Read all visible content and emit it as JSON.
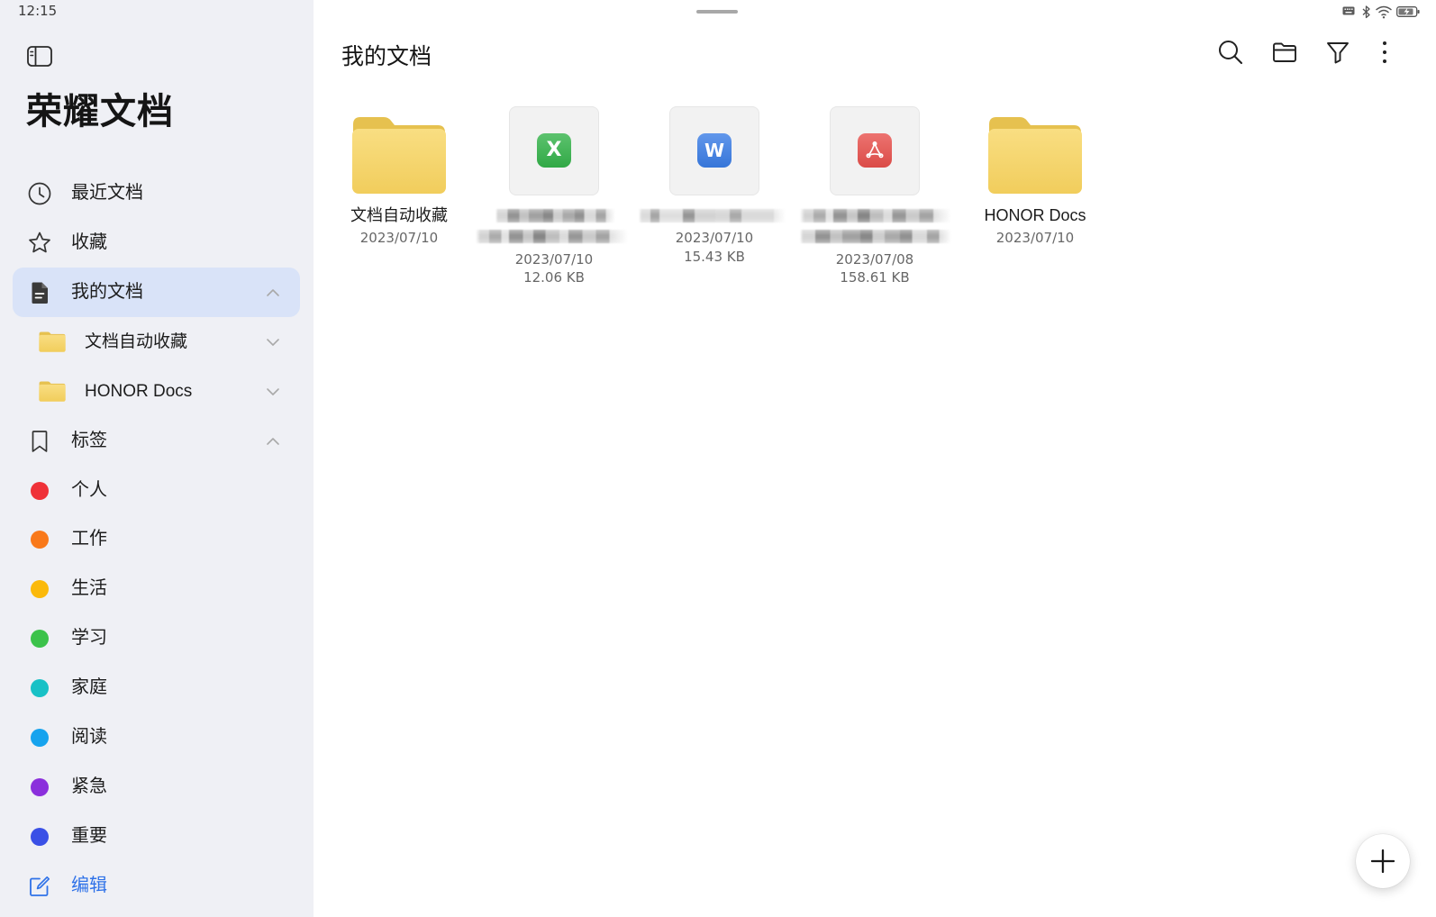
{
  "status_bar": {
    "time": "12:15",
    "icons": [
      "keyboard-icon",
      "bluetooth-icon",
      "wifi-icon",
      "battery-charging-icon"
    ]
  },
  "theme": {
    "accent": "#2f72e8",
    "sidebar_bg": "#eff0f5",
    "selected_bg": "#d9e3f8"
  },
  "sidebar": {
    "toggle_icon": "sidebar-toggle-icon",
    "app_title": "荣耀文档",
    "nav": {
      "recent": {
        "label": "最近文档",
        "icon": "clock-icon"
      },
      "favorites": {
        "label": "收藏",
        "icon": "star-icon"
      },
      "my_docs": {
        "label": "我的文档",
        "icon": "document-icon",
        "selected": true,
        "chevron": "chevron-up-icon"
      }
    },
    "folders": [
      {
        "label": "文档自动收藏",
        "icon": "folder-icon",
        "chevron": "chevron-down-icon"
      },
      {
        "label": "HONOR Docs",
        "icon": "folder-icon",
        "chevron": "chevron-down-icon"
      }
    ],
    "tags_section": {
      "label": "标签",
      "icon": "bookmark-icon",
      "chevron": "chevron-up-icon"
    },
    "tags": [
      {
        "label": "个人",
        "color": "#ef3138"
      },
      {
        "label": "工作",
        "color": "#f9791a"
      },
      {
        "label": "生活",
        "color": "#fbb90a"
      },
      {
        "label": "学习",
        "color": "#3bc24a"
      },
      {
        "label": "家庭",
        "color": "#18c1c6"
      },
      {
        "label": "阅读",
        "color": "#16a3ee"
      },
      {
        "label": "紧急",
        "color": "#8b2fdc"
      },
      {
        "label": "重要",
        "color": "#3a50e6"
      }
    ],
    "edit": {
      "label": "编辑",
      "icon": "edit-icon"
    }
  },
  "main": {
    "title": "我的文档",
    "toolbar": [
      {
        "icon": "search-icon"
      },
      {
        "icon": "folder-open-icon"
      },
      {
        "icon": "filter-icon"
      },
      {
        "icon": "more-vertical-icon"
      }
    ],
    "items": [
      {
        "icon": "folder-icon",
        "name": "文档自动收藏",
        "date": "2023/07/10"
      },
      {
        "icon": "excel-file-icon",
        "badge": "X",
        "color": "#34b34a",
        "date": "2023/07/10",
        "size": "12.06 KB"
      },
      {
        "icon": "word-file-icon",
        "badge": "W",
        "color": "#3a7de6",
        "date": "2023/07/10",
        "size": "15.43 KB"
      },
      {
        "icon": "pdf-file-icon",
        "color": "#e8504c",
        "date": "2023/07/08",
        "size": "158.61 KB"
      },
      {
        "icon": "folder-icon",
        "name": "HONOR Docs",
        "date": "2023/07/10"
      }
    ],
    "fab_icon": "plus-icon"
  }
}
